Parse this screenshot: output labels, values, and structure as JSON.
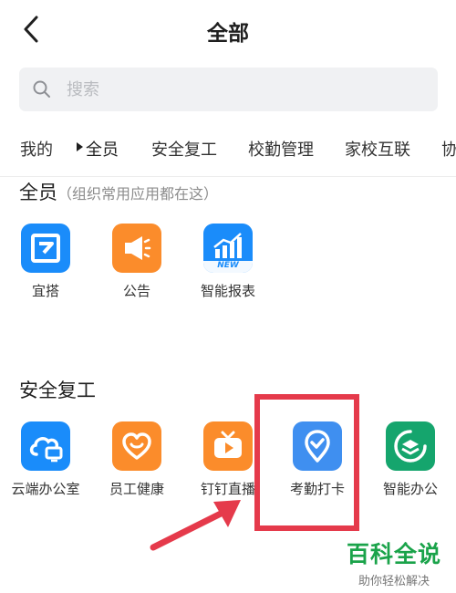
{
  "header": {
    "title": "全部"
  },
  "search": {
    "placeholder": "搜索"
  },
  "tabs": [
    {
      "label": "我的"
    },
    {
      "label": "全员"
    },
    {
      "label": "安全复工"
    },
    {
      "label": "校勤管理"
    },
    {
      "label": "家校互联"
    },
    {
      "label": "协"
    }
  ],
  "sections": [
    {
      "title": "全员",
      "hint": "（组织常用应用都在这）",
      "apps": [
        {
          "label": "宜搭",
          "icon": "yida-icon",
          "color": "#1a8cfa"
        },
        {
          "label": "公告",
          "icon": "megaphone-icon",
          "color": "#fb8c2b"
        },
        {
          "label": "智能报表",
          "icon": "report-chart-icon",
          "color": "#1a8cfa",
          "badge": "NEW"
        }
      ]
    },
    {
      "title": "安全复工",
      "apps": [
        {
          "label": "云端办公室",
          "icon": "cloud-office-icon",
          "color": "#1a8cfa"
        },
        {
          "label": "员工健康",
          "icon": "heart-icon",
          "color": "#fb8c2b"
        },
        {
          "label": "钉钉直播",
          "icon": "live-tv-icon",
          "color": "#fb8c2b"
        },
        {
          "label": "考勤打卡",
          "icon": "location-check-icon",
          "color": "#3f8ff0"
        },
        {
          "label": "智能办公",
          "icon": "smart-office-icon",
          "color": "#15a56d"
        }
      ]
    }
  ],
  "annotation": {
    "highlight_color": "#e53a4b"
  },
  "watermark": {
    "main": "百科全说",
    "sub": "助你轻松解决"
  }
}
